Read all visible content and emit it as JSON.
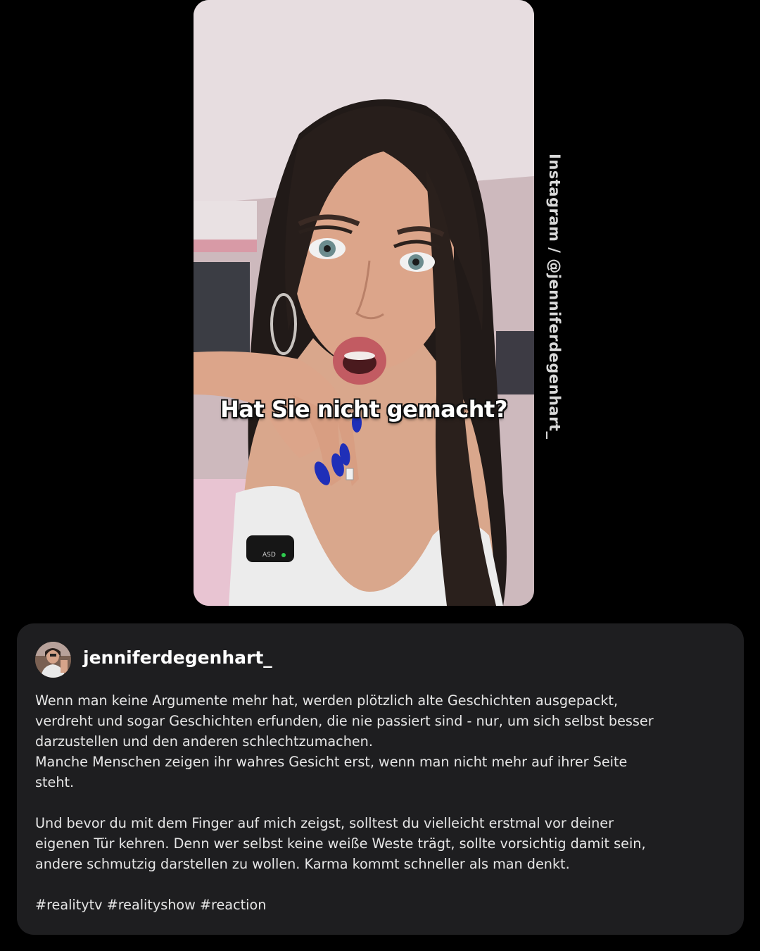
{
  "video": {
    "subtitle": "Hat Sie nicht gemacht?",
    "mic_label": "ASD"
  },
  "watermark": "Instagram / @jenniferdegenhart_",
  "post": {
    "username": "jenniferdegenhart_",
    "caption_lines": [
      "Wenn man keine Argumente mehr hat, werden plötzlich alte Geschichten ausgepackt,",
      "verdreht und sogar Geschichten erfunden, die nie passiert sind - nur, um sich selbst besser",
      "darzustellen und den anderen schlechtzumachen.",
      "Manche Menschen zeigen ihr wahres Gesicht erst, wenn man nicht mehr auf ihrer Seite",
      "steht.",
      "Und bevor du mit dem Finger auf mich zeigst, solltest du vielleicht erstmal vor deiner",
      "eigenen Tür kehren. Denn wer selbst keine weiße Weste trägt, sollte vorsichtig damit sein,",
      "andere schmutzig darstellen zu wollen. Karma kommt schneller als man denkt.",
      "#realitytv #realityshow #reaction"
    ]
  },
  "colors": {
    "page_background": "#000000",
    "card_background": "#1e1e20",
    "text_primary": "#ffffff",
    "text_body": "#e6e6e6",
    "nail_blue": "#1f2fb8"
  }
}
